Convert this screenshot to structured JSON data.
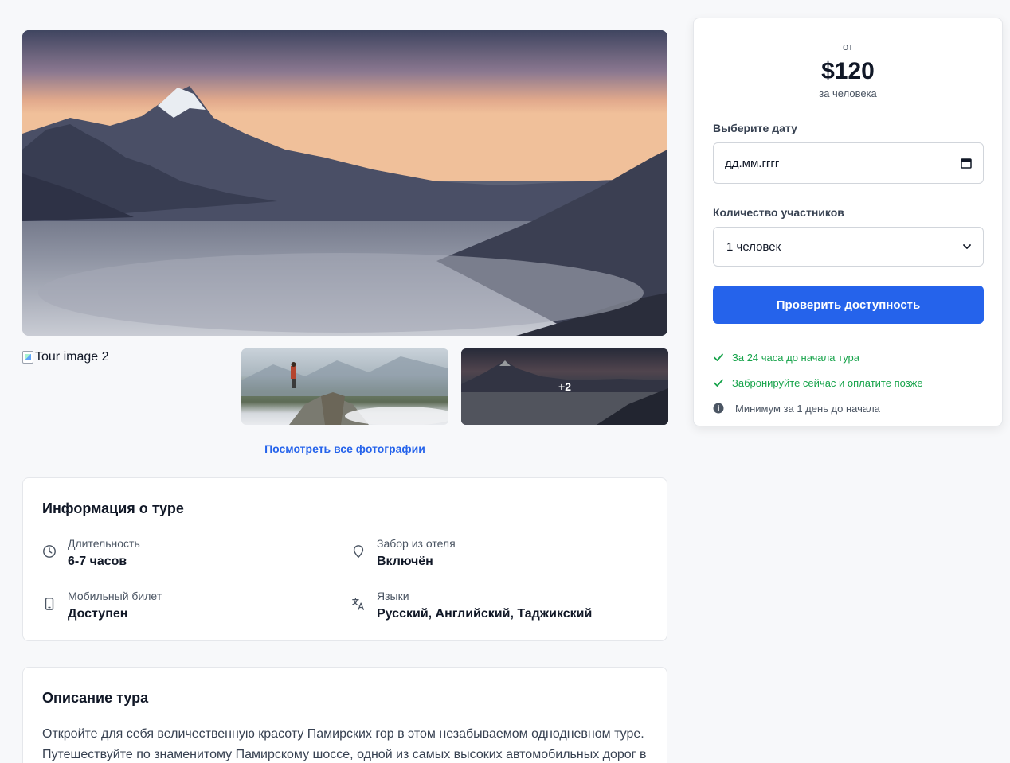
{
  "gallery": {
    "broken_image_alt": "Tour image 2",
    "more_overlay": "+2",
    "see_all_link": "Посмотреть все фотографии"
  },
  "info": {
    "title": "Информация о туре",
    "items": [
      {
        "icon": "clock-icon",
        "label": "Длительность",
        "value": "6-7 часов"
      },
      {
        "icon": "map-pin-icon",
        "label": "Забор из отеля",
        "value": "Включён"
      },
      {
        "icon": "phone-icon",
        "label": "Мобильный билет",
        "value": "Доступен"
      },
      {
        "icon": "translate-icon",
        "label": "Языки",
        "value": "Русский, Английский, Таджикский"
      }
    ]
  },
  "description": {
    "title": "Описание тура",
    "text": "Откройте для себя величественную красоту Памирских гор в этом незабываемом однодневном туре. Путешествуйте по знаменитому Памирскому шоссе, одной из самых высоких автомобильных дорог в"
  },
  "booking": {
    "from": "от",
    "price": "$120",
    "per_person": "за человека",
    "date_label": "Выберите дату",
    "date_placeholder": "дд.мм.гггг",
    "participants_label": "Количество участников",
    "participants_value": "1 человек",
    "check_button": "Проверить доступность",
    "notes": [
      {
        "type": "check",
        "text": "За 24 часа до начала тура"
      },
      {
        "type": "check",
        "text": "Забронируйте сейчас и оплатите позже"
      },
      {
        "type": "info",
        "text": "Минимум за 1 день до начала"
      }
    ]
  },
  "colors": {
    "accent": "#2563eb",
    "success": "#16a34a",
    "background": "#f7f8fa"
  }
}
